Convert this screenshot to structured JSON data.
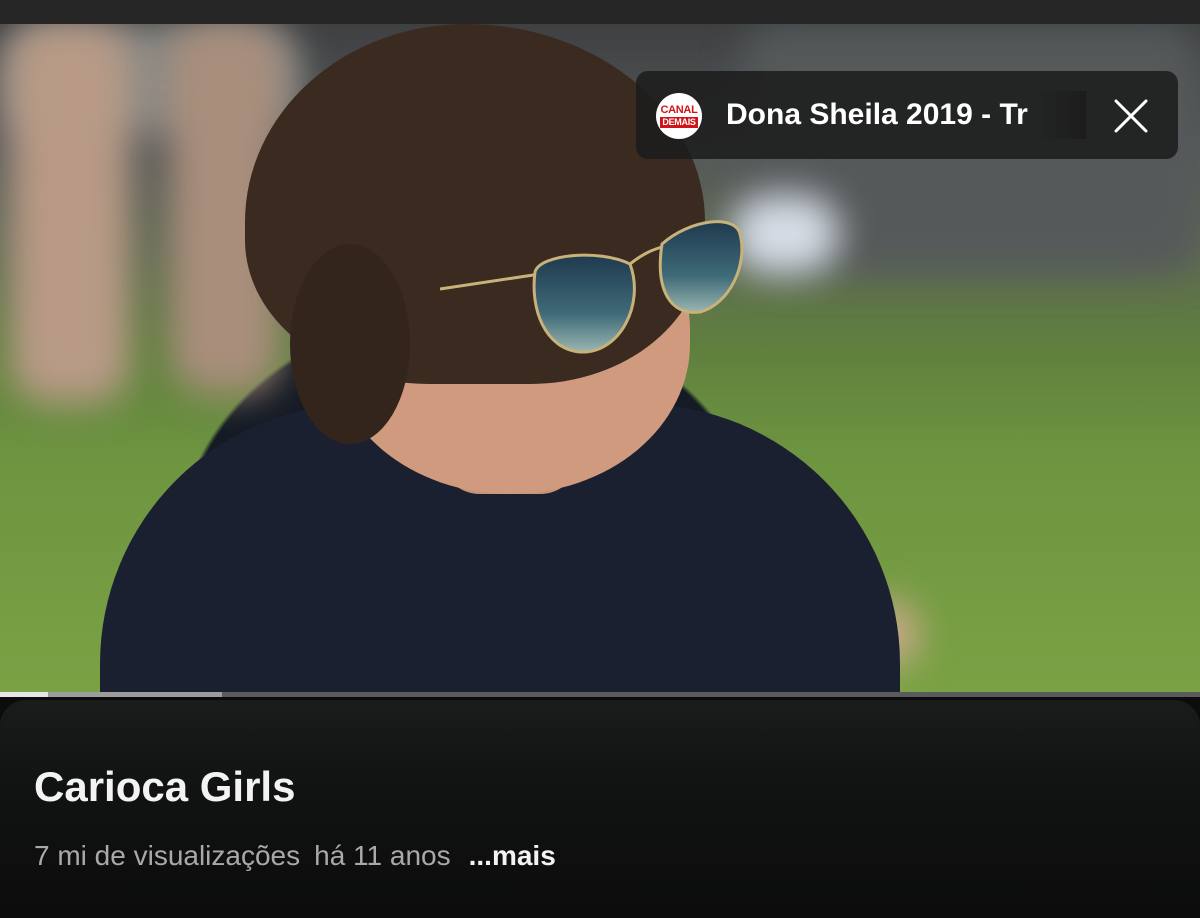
{
  "overlay": {
    "channel_logo_top": "CANAL",
    "channel_logo_bottom": "DEMAIS",
    "suggested_title": "Dona Sheila 2019 - Tr",
    "close_icon": "close-icon"
  },
  "player": {
    "progress_fraction": 0.04,
    "buffer_fraction": 0.185
  },
  "details": {
    "title": "Carioca Girls",
    "views": "7 mi de visualizações",
    "age": "há 11 anos",
    "more_label": "...mais"
  },
  "colors": {
    "panel": "#111312",
    "progress_fill": "#e6e6e6",
    "logo_red": "#d0141a"
  }
}
